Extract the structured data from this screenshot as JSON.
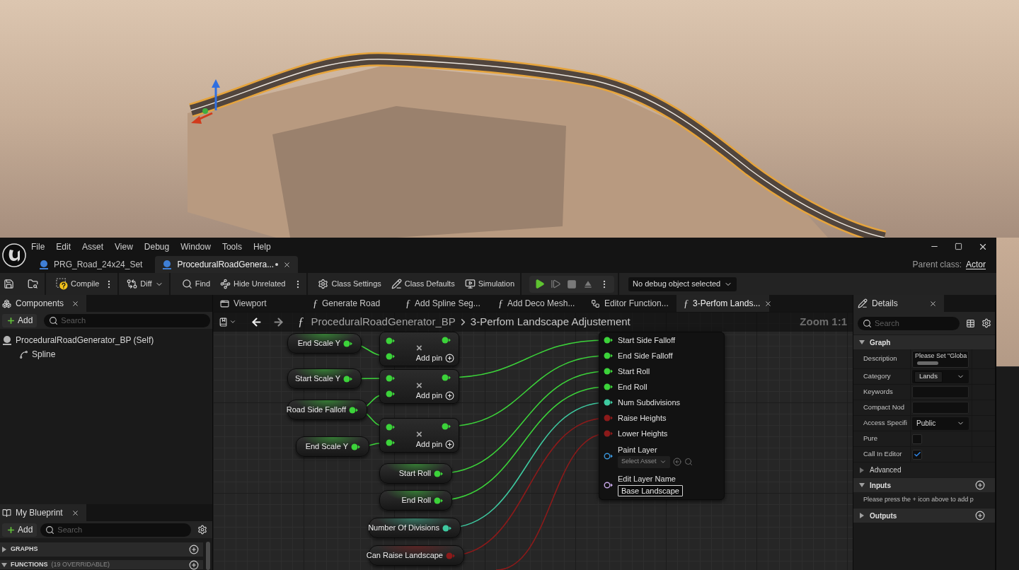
{
  "menu": [
    "File",
    "Edit",
    "Asset",
    "View",
    "Debug",
    "Window",
    "Tools",
    "Help"
  ],
  "document_tabs": [
    {
      "label": "PRG_Road_24x24_Set",
      "selected": false
    },
    {
      "label": "ProceduralRoadGenera...",
      "selected": true,
      "modified": true,
      "closable": true
    }
  ],
  "parent_class": {
    "label": "Parent class:",
    "value": "Actor"
  },
  "toolbar": {
    "buttons": [
      {
        "label": "Compile",
        "more": true
      },
      {
        "label": "Diff",
        "dropdown": true
      },
      {
        "label": "Find"
      },
      {
        "label": "Hide Unrelated",
        "more": true
      },
      {
        "label": "Class Settings"
      },
      {
        "label": "Class Defaults"
      },
      {
        "label": "Simulation"
      }
    ],
    "debug_object": "No debug object selected"
  },
  "components_panel": {
    "title": "Components",
    "add_label": "Add",
    "search_placeholder": "Search",
    "tree": [
      {
        "label": "ProceduralRoadGenerator_BP (Self)",
        "children": [
          {
            "label": "Spline"
          }
        ]
      }
    ]
  },
  "my_blueprint_panel": {
    "title": "My Blueprint",
    "add_label": "Add",
    "search_placeholder": "Search",
    "sections": [
      {
        "label": "GRAPHS",
        "expanded": false
      },
      {
        "label": "FUNCTIONS",
        "note": "(19 OVERRIDABLE)",
        "expanded": true
      }
    ]
  },
  "graph_tabs": [
    {
      "kind": "viewport",
      "label": "Viewport",
      "selected": false
    },
    {
      "kind": "function",
      "glyph": "ƒ",
      "label": "Generate Road",
      "selected": false
    },
    {
      "kind": "function",
      "glyph": "ƒ",
      "label": "Add Spline Seg...",
      "selected": false
    },
    {
      "kind": "function",
      "glyph": "ƒ",
      "label": "Add Deco Mesh...",
      "selected": false
    },
    {
      "kind": "editor",
      "label": "Editor Function...",
      "selected": false
    },
    {
      "kind": "function",
      "glyph": "ƒ",
      "label": "3-Perfom Lands...",
      "selected": true,
      "closable": true
    }
  ],
  "breadcrumb": {
    "glyph": "ƒ",
    "path": [
      "ProceduralRoadGenerator_BP",
      "3-Perfom Landscape Adjustement"
    ],
    "zoom": "Zoom 1:1"
  },
  "graph_nodes": [
    {
      "kind": "variable",
      "label": "End Scale Y",
      "color": "#3cd33a"
    },
    {
      "kind": "operator",
      "symbol": "×",
      "action": "Add pin",
      "color": "#3cd33a"
    },
    {
      "kind": "variable",
      "label": "Start Scale Y",
      "color": "#3cd33a"
    },
    {
      "kind": "operator",
      "symbol": "×",
      "action": "Add pin",
      "color": "#3cd33a"
    },
    {
      "kind": "variable",
      "label": "Road Side Falloff",
      "color": "#3cd33a"
    },
    {
      "kind": "variable",
      "label": "End Scale Y",
      "color": "#3cd33a"
    },
    {
      "kind": "operator",
      "symbol": "×",
      "action": "Add pin",
      "color": "#3cd33a"
    },
    {
      "kind": "variable",
      "label": "Start Roll",
      "color": "#3cd33a"
    },
    {
      "kind": "variable",
      "label": "End Roll",
      "color": "#3cd33a"
    },
    {
      "kind": "variable",
      "label": "Number Of Divisions",
      "color": "#3ec9a0"
    },
    {
      "kind": "variable",
      "label": "Can Raise Landscape",
      "color": "#8c1a1a"
    },
    {
      "kind": "function",
      "pins": [
        {
          "kind": "plain",
          "label": "Start Side Falloff",
          "color": "#3cd33a",
          "connected": true
        },
        {
          "kind": "plain",
          "label": "End Side Falloff",
          "color": "#3cd33a",
          "connected": true
        },
        {
          "kind": "plain",
          "label": "Start Roll",
          "color": "#3cd33a",
          "connected": true
        },
        {
          "kind": "plain",
          "label": "End Roll",
          "color": "#3cd33a",
          "connected": true
        },
        {
          "kind": "plain",
          "label": "Num Subdivisions",
          "color": "#3ec9a0",
          "connected": true
        },
        {
          "kind": "plain",
          "label": "Raise Heights",
          "color": "#8c1a1a",
          "connected": true
        },
        {
          "kind": "plain",
          "label": "Lower Heights",
          "color": "#8c1a1a",
          "connected": true
        },
        {
          "kind": "asset",
          "label": "Paint Layer",
          "color": "#3a96dc",
          "connected": false,
          "placeholder": "Select Asset"
        },
        {
          "kind": "text",
          "label": "Edit Layer Name",
          "color": "#c9a8ea",
          "connected": false,
          "value": "Base Landscape"
        }
      ]
    }
  ],
  "details": {
    "title": "Details",
    "search_placeholder": "Search",
    "sections": [
      {
        "kind": "category",
        "label": "Graph",
        "expanded": true,
        "rows": [
          {
            "kind": "multiline",
            "label": "Description",
            "value": "Please Set \"Globa"
          },
          {
            "kind": "combo",
            "label": "Category",
            "value": "Lands"
          },
          {
            "kind": "text",
            "label": "Keywords"
          },
          {
            "kind": "text",
            "label": "Compact Nod"
          },
          {
            "kind": "dropdown",
            "label": "Access Specifi",
            "value": "Public"
          },
          {
            "kind": "checkbox",
            "label": "Pure",
            "checked": false
          },
          {
            "kind": "checkbox",
            "label": "Call In Editor",
            "checked": true
          }
        ]
      },
      {
        "kind": "subcategory",
        "label": "Advanced",
        "expanded": false
      },
      {
        "kind": "category",
        "label": "Inputs",
        "expanded": true,
        "addable": true,
        "note": "Please press the + icon above to add p"
      },
      {
        "kind": "category",
        "label": "Outputs",
        "expanded": false,
        "addable": true
      }
    ]
  }
}
